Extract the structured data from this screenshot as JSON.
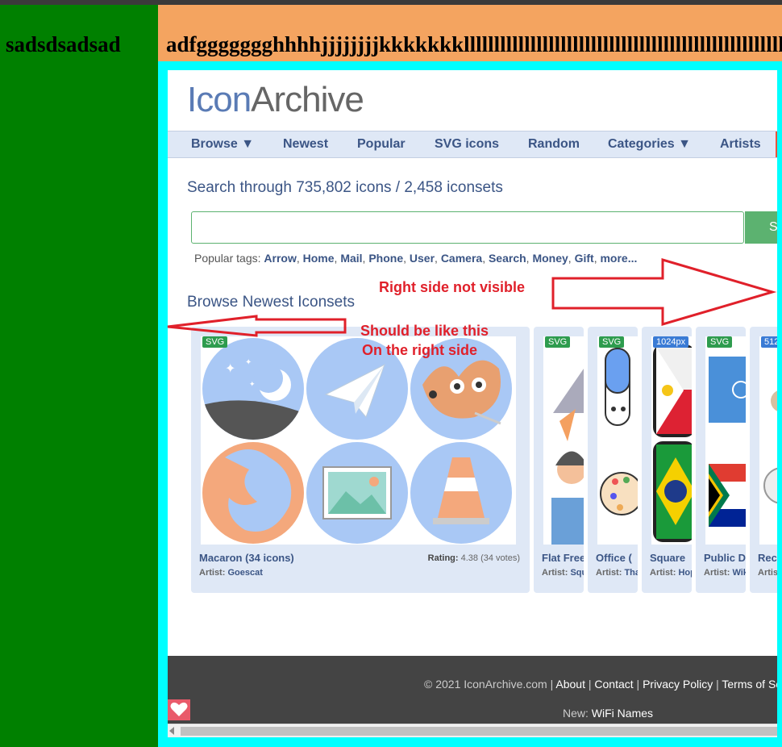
{
  "outer": {
    "left_label": "sadsdsadsad",
    "header_label": "adfggggggghhhhjjjjjjjjkkkkkkklllllllllllllllllllllllllllllllllllllllllllllllllllllll"
  },
  "site": {
    "logo_icon": "Icon",
    "logo_archive": "Archive",
    "nav": [
      "Browse ▼",
      "Newest",
      "Popular",
      "SVG icons",
      "Random",
      "Categories ▼",
      "Artists"
    ],
    "search_title": "Search through 735,802 icons / 2,458 iconsets",
    "search_button": "S",
    "tags_label": "Popular tags:",
    "tags": [
      "Arrow",
      "Home",
      "Mail",
      "Phone",
      "User",
      "Camera",
      "Search",
      "Money",
      "Gift",
      "more..."
    ],
    "browse_title": "Browse Newest Iconsets",
    "cards": [
      {
        "badge": "SVG",
        "title": "Macaron (34 icons)",
        "artist_label": "Artist:",
        "artist": "Goescat",
        "rating_label": "Rating:",
        "rating": "4.38 (34 votes)"
      },
      {
        "badge": "SVG",
        "title": "Flat Free",
        "artist_label": "Artist:",
        "artist": "Squ"
      },
      {
        "badge": "SVG",
        "title": "Office (",
        "artist_label": "Artist:",
        "artist": "Tha"
      },
      {
        "badge": "1024px",
        "title": "Square",
        "artist_label": "Artist:",
        "artist": "Hop"
      },
      {
        "badge": "SVG",
        "title": "Public D",
        "artist_label": "Artist:",
        "artist": "Wik"
      },
      {
        "badge": "512",
        "title": "Rec",
        "artist_label": "Artis",
        "artist": ""
      }
    ],
    "footer": {
      "copyright": "© 2021 IconArchive.com",
      "links": [
        "About",
        "Contact",
        "Privacy Policy",
        "Terms of Se"
      ],
      "new_label": "New:",
      "new_link": "WiFi Names"
    }
  },
  "annotations": {
    "right_side": "Right side not visible",
    "should_be": "Should be like this",
    "on_right": "On the right side"
  },
  "colors": {
    "outer_green": "#008000",
    "outer_orange": "#f4a460",
    "outer_cyan": "#00ffff",
    "site_blue": "#3b5585",
    "accent_green": "#5cb270",
    "annotation_red": "#e0202a"
  }
}
